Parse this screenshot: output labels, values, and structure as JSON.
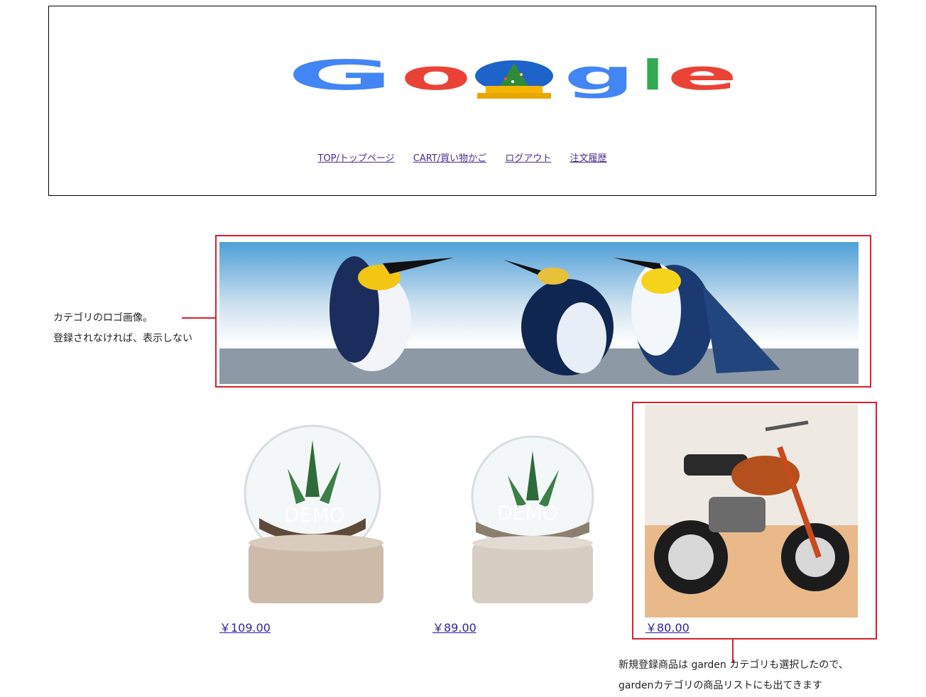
{
  "header": {
    "logo_text": "Google",
    "nav": [
      {
        "label": "TOP/トップページ"
      },
      {
        "label": "CART/買い物かご"
      },
      {
        "label": "ログアウト"
      },
      {
        "label": "注文履歴"
      }
    ]
  },
  "annotations": {
    "category_logo_line1": "カテゴリのロゴ画像。",
    "category_logo_line2": "登録されなければ、表示しない",
    "new_product_line1": "新規登録商品は garden カテゴリも選択したので、",
    "new_product_line2": "gardenカテゴリの商品リストにも出てきます"
  },
  "products": [
    {
      "image": "terrarium-plant-large",
      "watermark": "DEMO",
      "price": "￥109.00"
    },
    {
      "image": "terrarium-plant-small",
      "watermark": "DEMO",
      "price": "￥89.00"
    },
    {
      "image": "motorcycle",
      "price": "￥80.00"
    }
  ],
  "colors": {
    "highlight": "#d7212b",
    "link": "#4b2c8f",
    "price_link": "#2a1fa0"
  }
}
